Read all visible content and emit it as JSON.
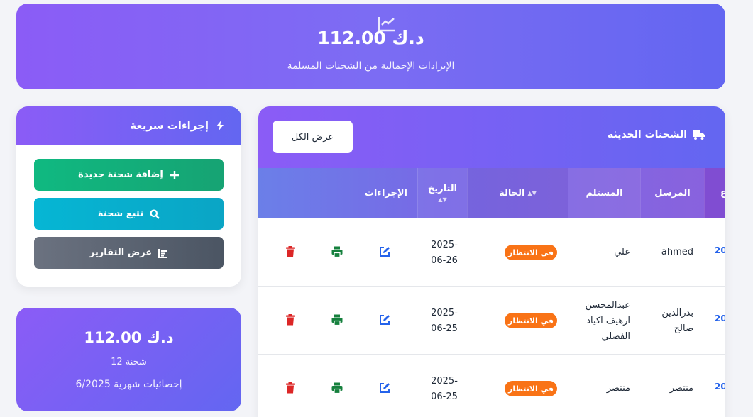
{
  "banner": {
    "icon": "chart-line-icon",
    "amount": "112.00 د.ك",
    "subtitle": "الإيرادات الإجمالية من الشحنات المسلمة"
  },
  "quick_actions": {
    "title": "إجراءات سريعة",
    "title_icon": "bolt-icon",
    "buttons": [
      {
        "label": "إضافة شحنة جديدة",
        "icon": "plus-icon",
        "color": "#10b981"
      },
      {
        "label": "تتبع شحنة",
        "icon": "search-icon",
        "color": "#06b6d4"
      },
      {
        "label": "عرض التقارير",
        "icon": "chart-bar-icon",
        "color": "#6b7280"
      }
    ]
  },
  "monthly_stats": {
    "amount": "112.00 د.ك",
    "count": "12 شحنة",
    "label": "إحصائيات شهرية 6/2025"
  },
  "recent_shipments": {
    "title": "الشحنات الحديثة",
    "title_icon": "truck-icon",
    "view_all_label": "عرض الكل",
    "columns": {
      "id": "ع",
      "sender": "المرسل",
      "receiver": "المستلم",
      "status": "الحالة",
      "date": "التاريخ",
      "actions": "الإجراءات"
    },
    "rows": [
      {
        "id": "20",
        "sender": "ahmed",
        "receiver": "علي",
        "status": "في الانتظار",
        "date_line1": "2025-",
        "date_line2": "06-26"
      },
      {
        "id": "20",
        "sender": "بدرالدين صالح",
        "receiver": "عبدالمحسن ارهيف اكياد الفضلي",
        "status": "في الانتظار",
        "date_line1": "2025-",
        "date_line2": "06-25"
      },
      {
        "id": "20",
        "sender": "منتصر",
        "receiver": "منتصر",
        "status": "في الانتظار",
        "date_line1": "2025-",
        "date_line2": "06-25"
      }
    ]
  },
  "colors": {
    "brand_start": "#8b5cf6",
    "brand_end": "#6366f1",
    "status_pending": "#f97316",
    "delete": "#dc2626",
    "print": "#15803d",
    "edit": "#2563eb"
  }
}
